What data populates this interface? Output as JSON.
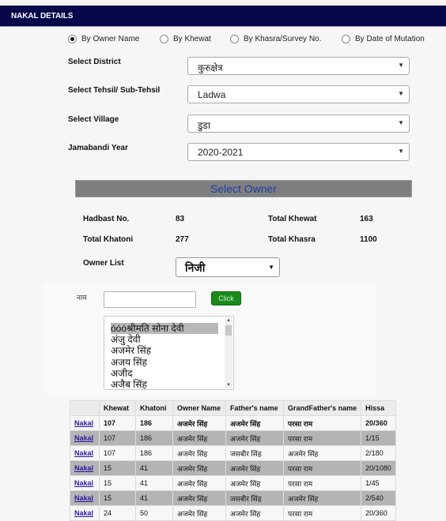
{
  "header": {
    "title": "NAKAL DETAILS"
  },
  "search_modes": [
    {
      "label": "By Owner Name",
      "selected": true
    },
    {
      "label": "By Khewat",
      "selected": false
    },
    {
      "label": "By Khasra/Survey No.",
      "selected": false
    },
    {
      "label": "By Date of Mutation",
      "selected": false
    }
  ],
  "form": {
    "district": {
      "label": "Select District",
      "value": "कुरुक्षेत्र"
    },
    "tehsil": {
      "label": "Select Tehsil/ Sub-Tehsil",
      "value": "Ladwa"
    },
    "village": {
      "label": "Select Village",
      "value": "डुडा"
    },
    "year": {
      "label": "Jamabandi Year",
      "value": "2020-2021"
    }
  },
  "section_title": "Select Owner",
  "stats": {
    "hadbast": {
      "label": "Hadbast No.",
      "value": "83"
    },
    "total_khewat": {
      "label": "Total Khewat",
      "value": "163"
    },
    "total_khatoni": {
      "label": "Total Khatoni",
      "value": "277"
    },
    "total_khasra": {
      "label": "Total Khasra",
      "value": "1100"
    }
  },
  "owner_list": {
    "label": "Owner List",
    "value": "निजी"
  },
  "name_search": {
    "label": "नाम",
    "value": "",
    "button": "Click"
  },
  "owners": [
    "óóóश्रीमति सोना देवी",
    "अंजु देवी",
    "अजमेर सिंह",
    "अजय सिंह",
    "अजीद",
    "अजैब सिंह"
  ],
  "selected_owner_index": 0,
  "table": {
    "columns": [
      "",
      "Khewat",
      "Khatoni",
      "Owner Name",
      "Father's name",
      "GrandFather's name",
      "Hissa"
    ],
    "link_label": "Nakal",
    "rows": [
      {
        "khewat": "107",
        "khatoni": "186",
        "owner": "अजमेर सिंह",
        "father": "अजमेर सिंह",
        "grandfather": "परसा राम",
        "hissa": "20/360"
      },
      {
        "khewat": "107",
        "khatoni": "186",
        "owner": "अजमेर सिंह",
        "father": "अजमेर सिंह",
        "grandfather": "परसा राम",
        "hissa": "1/15"
      },
      {
        "khewat": "107",
        "khatoni": "186",
        "owner": "अजमेर सिंह",
        "father": "जसबीर सिंह",
        "grandfather": "अजमेर सिंह",
        "hissa": "2/180"
      },
      {
        "khewat": "15",
        "khatoni": "41",
        "owner": "अजमेर सिंह",
        "father": "अजमेर सिंह",
        "grandfather": "परसा राम",
        "hissa": "20/1080"
      },
      {
        "khewat": "15",
        "khatoni": "41",
        "owner": "अजमेर सिंह",
        "father": "अजमेर सिंह",
        "grandfather": "परसा राम",
        "hissa": "1/45"
      },
      {
        "khewat": "15",
        "khatoni": "41",
        "owner": "अजमेर सिंह",
        "father": "जसबीर सिंह",
        "grandfather": "अजमेर सिंह",
        "hissa": "2/540"
      },
      {
        "khewat": "24",
        "khatoni": "50",
        "owner": "अजमेर सिंह",
        "father": "अजमेर सिंह",
        "grandfather": "परसा राम",
        "hissa": "20/360"
      }
    ]
  }
}
